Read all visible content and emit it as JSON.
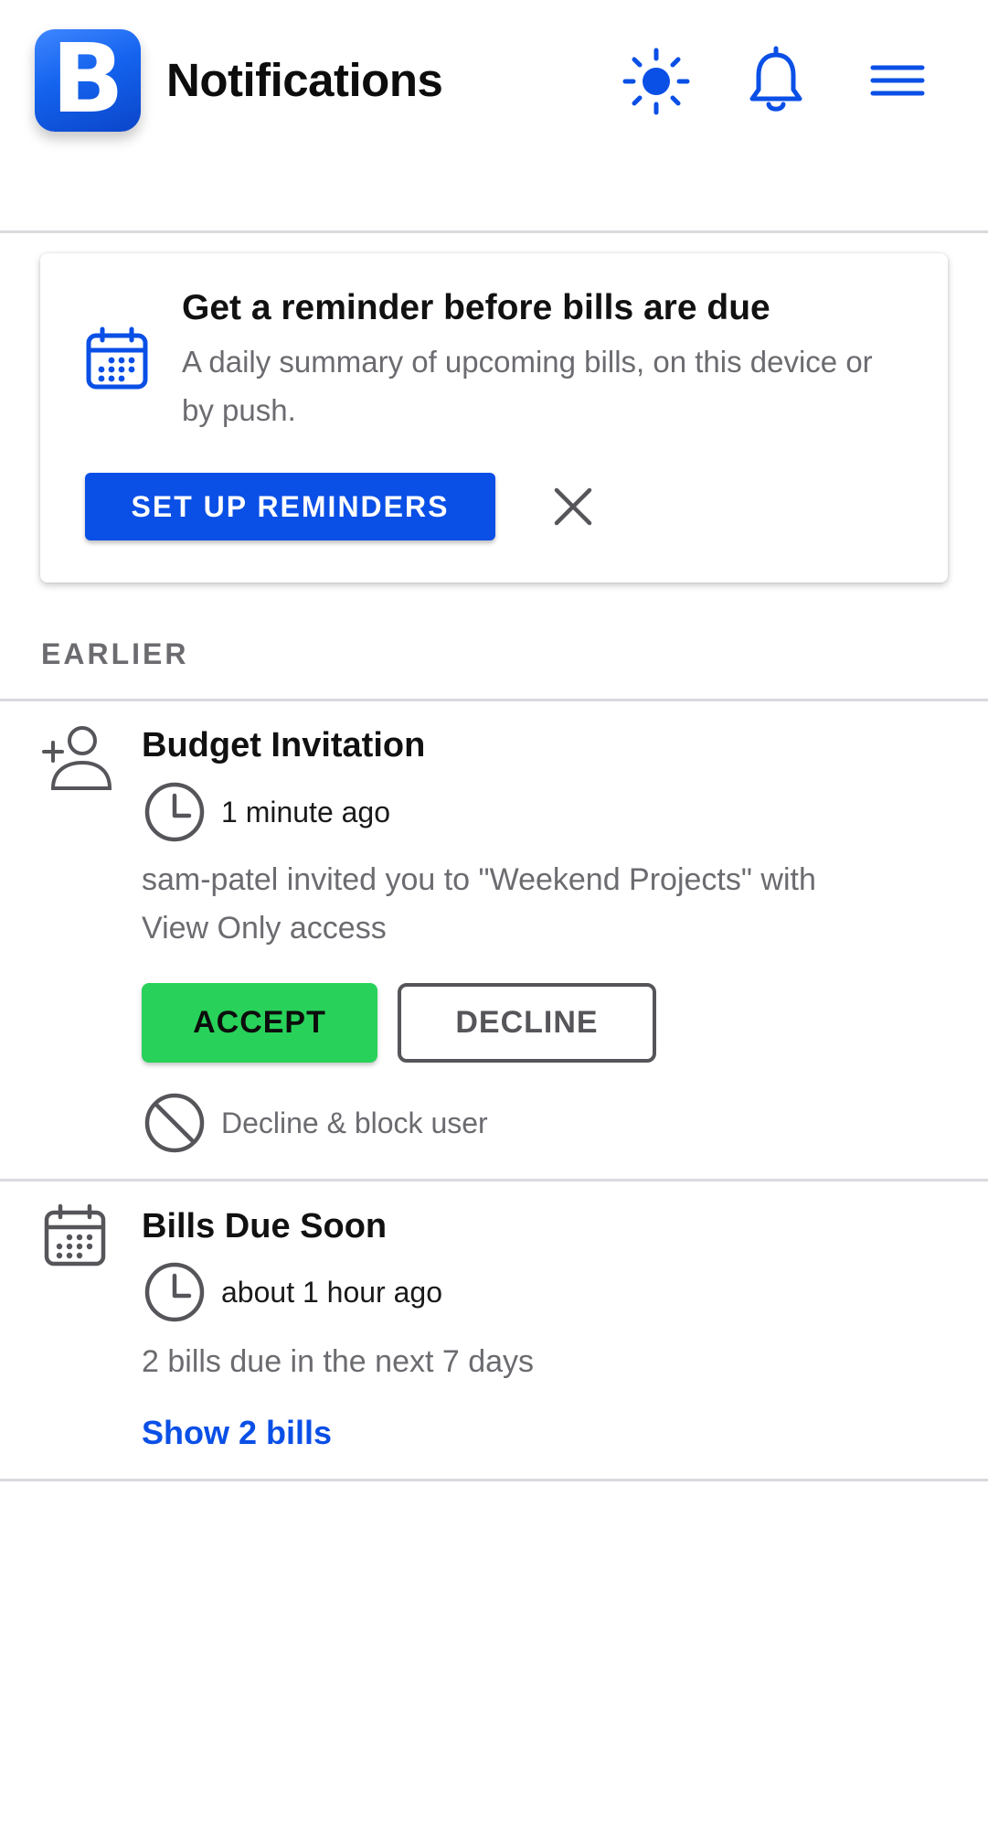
{
  "header": {
    "logo_letter": "B",
    "title": "Notifications",
    "icons": [
      "sun-icon",
      "bell-icon",
      "menu-icon"
    ]
  },
  "reminder_card": {
    "icon": "calendar-icon",
    "title": "Get a reminder before bills are due",
    "description": "A daily summary of upcoming bills, on this device or by push.",
    "button_label": "SET UP REMINDERS",
    "close_icon": "close-icon"
  },
  "section_label": "EARLIER",
  "notifications": [
    {
      "icon": "add-user-icon",
      "title": "Budget Invitation",
      "time": "1 minute ago",
      "body": "sam-patel invited you to \"Weekend Projects\" with View Only access",
      "accept_label": "ACCEPT",
      "decline_label": "DECLINE",
      "block_label": "Decline & block user"
    },
    {
      "icon": "calendar-icon",
      "title": "Bills Due Soon",
      "time": "about 1 hour ago",
      "body": "2 bills due in the next 7 days",
      "link_label": "Show 2 bills"
    }
  ],
  "colors": {
    "brand_blue": "#0a4fe6",
    "accept_green": "#28d25a",
    "muted_text": "#6b6b70",
    "divider": "#d9d9de"
  }
}
